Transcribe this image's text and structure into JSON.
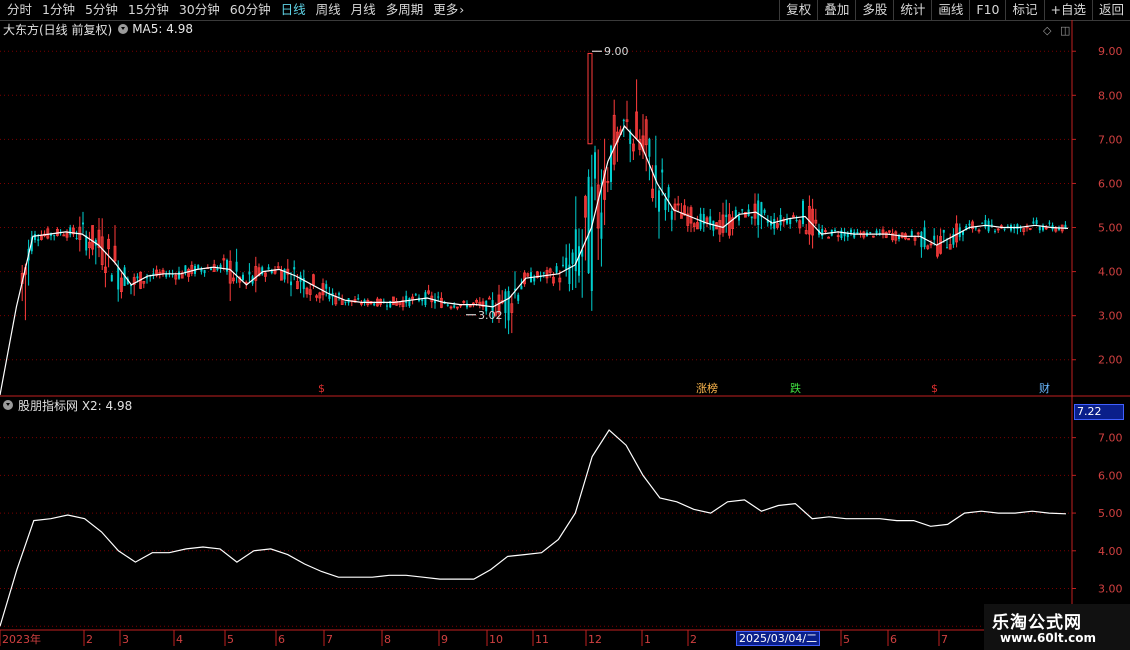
{
  "toolbar": {
    "periods": [
      {
        "label": "分时",
        "active": false
      },
      {
        "label": "1分钟",
        "active": false
      },
      {
        "label": "5分钟",
        "active": false
      },
      {
        "label": "15分钟",
        "active": false
      },
      {
        "label": "30分钟",
        "active": false
      },
      {
        "label": "60分钟",
        "active": false
      },
      {
        "label": "日线",
        "active": true
      },
      {
        "label": "周线",
        "active": false
      },
      {
        "label": "月线",
        "active": false
      },
      {
        "label": "多周期",
        "active": false
      },
      {
        "label": "更多",
        "active": false
      }
    ],
    "buttons": [
      "复权",
      "叠加",
      "多股",
      "统计",
      "画线",
      "F10",
      "标记",
      "+自选",
      "返回"
    ]
  },
  "main_chart": {
    "title": "大东方(日线 前复权)",
    "ma_label": "MA5: 4.98",
    "high_label": "9.00",
    "low_label": "3.02",
    "y_ticks": [
      "9.00",
      "8.00",
      "7.00",
      "6.00",
      "5.00",
      "4.00",
      "3.00",
      "2.00"
    ],
    "ylim": [
      1.2,
      9.3
    ],
    "markers": [
      {
        "text": "$",
        "color": "#e03030"
      },
      {
        "text": "涨榜",
        "color": "#ffb84d"
      },
      {
        "text": "跌",
        "color": "#40e040"
      },
      {
        "text": "$",
        "color": "#e03030"
      },
      {
        "text": "财",
        "color": "#6ab8ff"
      }
    ]
  },
  "sub_chart": {
    "title": "股朋指标网 X2: 4.98",
    "current_value": "7.22",
    "y_ticks": [
      "7.00",
      "6.00",
      "5.00",
      "4.00",
      "3.00",
      "2.00"
    ],
    "ylim": [
      1.9,
      7.6
    ]
  },
  "x_axis": {
    "labels": [
      "2023年",
      "2",
      "3",
      "4",
      "5",
      "6",
      "7",
      "8",
      "9",
      "10",
      "11",
      "12",
      "1",
      "2",
      "",
      "5",
      "6",
      "7"
    ],
    "cursor_date": "2025/03/04/二"
  },
  "watermark": {
    "line1": "乐淘公式网",
    "line2": "www.60lt.com"
  },
  "colors": {
    "up": "#ff3d3d",
    "down": "#00d0d0",
    "ma": "#ffffff",
    "grid": "#7a0000",
    "axis": "#c02020"
  },
  "chart_data": {
    "type": "line",
    "title": "大东方(日线 前复权)",
    "series": [
      {
        "name": "MA5",
        "values": [
          1.2,
          3.2,
          4.8,
          4.85,
          4.9,
          4.85,
          4.6,
          4.2,
          3.7,
          3.9,
          3.95,
          3.95,
          4.05,
          4.1,
          4.05,
          3.7,
          4.0,
          4.05,
          3.9,
          3.7,
          3.5,
          3.35,
          3.3,
          3.3,
          3.3,
          3.35,
          3.4,
          3.3,
          3.25,
          3.25,
          3.2,
          3.4,
          3.85,
          3.9,
          3.95,
          4.15,
          5.0,
          6.5,
          7.3,
          6.9,
          6.0,
          5.4,
          5.25,
          5.1,
          5.0,
          5.3,
          5.35,
          5.1,
          5.2,
          5.25,
          4.85,
          4.9,
          4.85,
          4.85,
          4.85,
          4.8,
          4.8,
          4.6,
          4.8,
          5.0,
          5.05,
          5.0,
          5.0,
          5.05,
          5.0,
          4.98
        ]
      },
      {
        "name": "X2",
        "values": [
          2.0,
          3.5,
          4.8,
          4.85,
          4.95,
          4.85,
          4.5,
          4.0,
          3.7,
          3.95,
          3.95,
          4.05,
          4.1,
          4.05,
          3.7,
          4.0,
          4.05,
          3.9,
          3.65,
          3.45,
          3.3,
          3.3,
          3.3,
          3.35,
          3.35,
          3.3,
          3.25,
          3.25,
          3.25,
          3.5,
          3.85,
          3.9,
          3.95,
          4.3,
          5.0,
          6.5,
          7.2,
          6.8,
          6.0,
          5.4,
          5.3,
          5.1,
          5.0,
          5.3,
          5.35,
          5.05,
          5.2,
          5.25,
          4.85,
          4.9,
          4.85,
          4.85,
          4.85,
          4.8,
          4.8,
          4.65,
          4.7,
          5.0,
          5.05,
          5.0,
          5.0,
          5.05,
          5.0,
          4.98
        ]
      }
    ]
  }
}
